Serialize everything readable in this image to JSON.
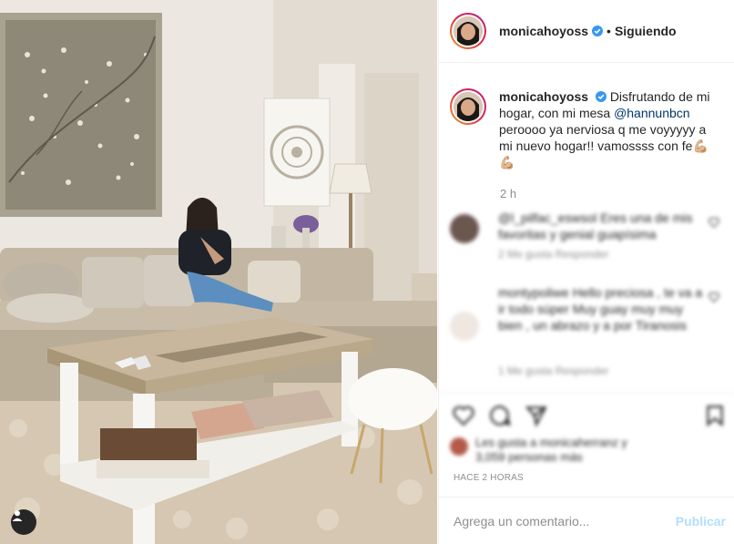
{
  "post": {
    "username": "monicahoyoss",
    "follow_status": "Siguiendo",
    "separator": "•",
    "caption_text": "Disfrutando de mi hogar, con mi mesa ",
    "caption_mention": "@hannunbcn",
    "caption_text2": " peroooo ya nerviosa q me voyyyyy a mi nuevo hogar!! vamossss con fe",
    "caption_emoji": "💪🏼💪🏼",
    "caption_time": "2 h",
    "timestamp": "HACE 2 HORAS"
  },
  "comments": [
    {
      "text": "@l_pilfac_eswsol Eres una de mis favoritas y genial guapísima",
      "meta": "2 Me gusta    Responder"
    },
    {
      "text": "montypoliwe Hello preciosa , te va a ir todo súper Muy guay muy muy bien , un abrazo y a por Tiranosis",
      "meta": "1 Me gusta    Responder"
    }
  ],
  "likes_text": "Les gusta a monicaherranz y 3,059 personas más",
  "add_comment": {
    "placeholder": "Agrega un comentario...",
    "publish_label": "Publicar"
  },
  "colors": {
    "link": "#00376b",
    "publish_disabled": "#b2dffc",
    "verified": "#3897f0",
    "like_heart": "#ed4956"
  }
}
